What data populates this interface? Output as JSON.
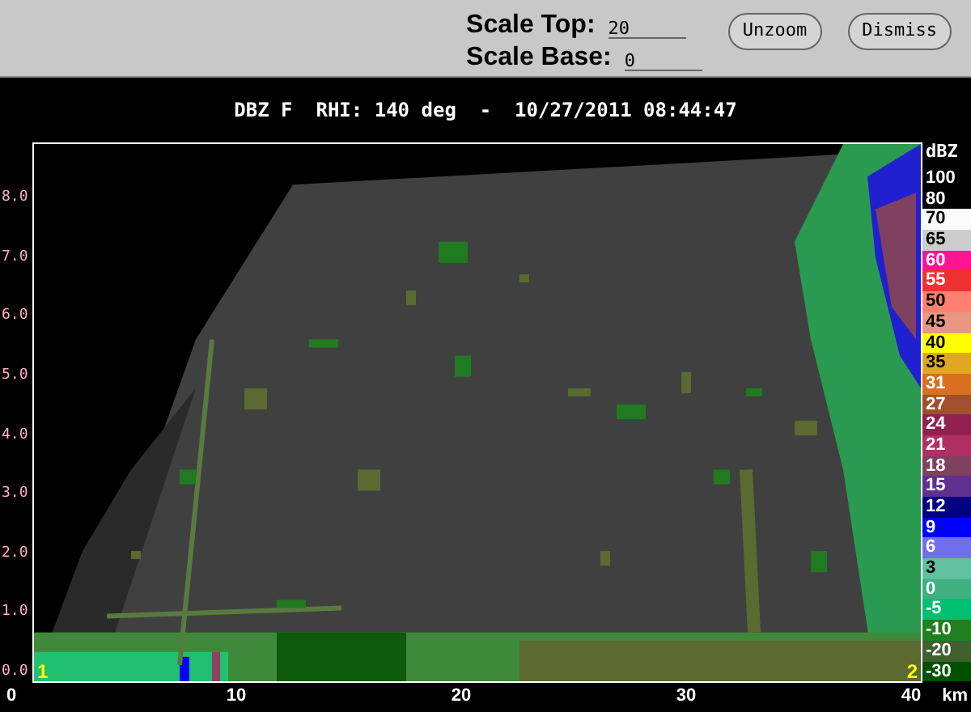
{
  "toolbar": {
    "fields": [
      {
        "label": "Scale Top:",
        "value": "20"
      },
      {
        "label": "Scale Base:",
        "value": "0"
      }
    ],
    "buttons": [
      "Unzoom",
      "Dismiss"
    ]
  },
  "plot": {
    "title": "DBZ F  RHI: 140 deg  -  10/27/2011 08:44:47",
    "y_ticks": [
      "8.0",
      "7.0",
      "6.0",
      "5.0",
      "4.0",
      "3.0",
      "2.0",
      "1.0",
      "0.0"
    ],
    "x_ticks": [
      "0",
      "10",
      "20",
      "30",
      "40"
    ],
    "x_unit": "km",
    "markers": [
      "1",
      "2"
    ]
  },
  "legend": {
    "unit": "dBZ",
    "entries": [
      {
        "label": "100",
        "color": "#000000"
      },
      {
        "label": "80",
        "color": "#000000"
      },
      {
        "label": "70",
        "color": "#fafafa"
      },
      {
        "label": "65",
        "color": "#cccccc"
      },
      {
        "label": "60",
        "color": "#ff1493"
      },
      {
        "label": "55",
        "color": "#ee3030"
      },
      {
        "label": "50",
        "color": "#ff8070"
      },
      {
        "label": "45",
        "color": "#e89880"
      },
      {
        "label": "40",
        "color": "#ffff00"
      },
      {
        "label": "35",
        "color": "#e0a820"
      },
      {
        "label": "31",
        "color": "#d87020"
      },
      {
        "label": "27",
        "color": "#a05030"
      },
      {
        "label": "24",
        "color": "#902050"
      },
      {
        "label": "21",
        "color": "#b03060"
      },
      {
        "label": "18",
        "color": "#804060"
      },
      {
        "label": "15",
        "color": "#603090"
      },
      {
        "label": "12",
        "color": "#000080"
      },
      {
        "label": "9",
        "color": "#0000ff"
      },
      {
        "label": "6",
        "color": "#7070ee"
      },
      {
        "label": "3",
        "color": "#60c0a0"
      },
      {
        "label": "0",
        "color": "#40b080"
      },
      {
        "label": "-5",
        "color": "#00c070"
      },
      {
        "label": "-10",
        "color": "#208020"
      },
      {
        "label": "-20",
        "color": "#406030"
      },
      {
        "label": "-30",
        "color": "#005000"
      }
    ]
  }
}
